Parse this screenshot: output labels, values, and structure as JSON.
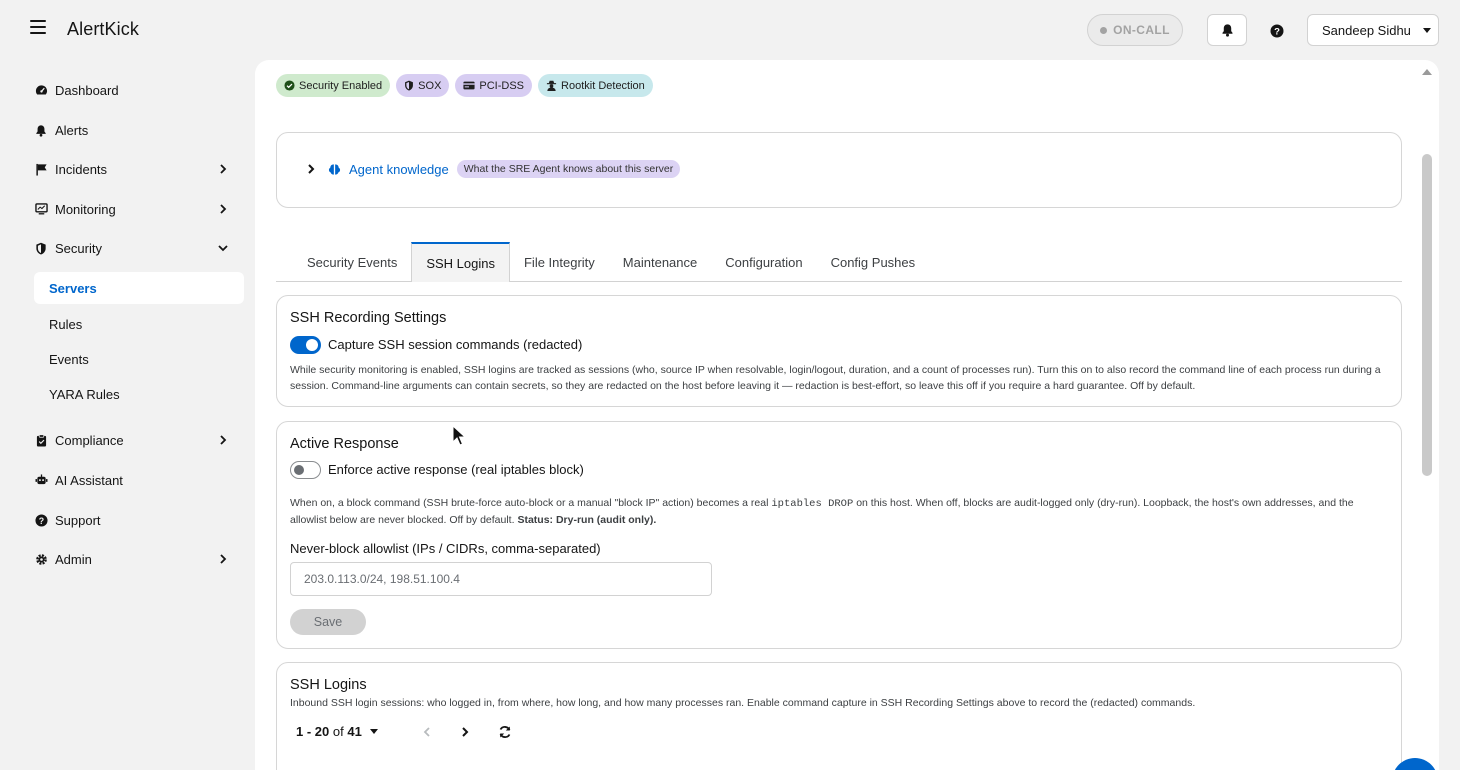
{
  "header": {
    "brand": "AlertKick",
    "oncall_label": "ON-CALL",
    "user_name": "Sandeep Sidhu"
  },
  "sidebar": {
    "items": [
      {
        "label": "Dashboard",
        "icon": "dashboard-icon"
      },
      {
        "label": "Alerts",
        "icon": "bell-icon"
      },
      {
        "label": "Incidents",
        "icon": "flag-icon"
      },
      {
        "label": "Monitoring",
        "icon": "monitor-icon"
      },
      {
        "label": "Security",
        "icon": "shield-icon"
      },
      {
        "label": "Compliance",
        "icon": "clipboard-icon"
      },
      {
        "label": "AI Assistant",
        "icon": "robot-icon"
      },
      {
        "label": "Support",
        "icon": "help-circle-icon"
      },
      {
        "label": "Admin",
        "icon": "gear-icon"
      }
    ],
    "security_sub": [
      "Servers",
      "Rules",
      "Events",
      "YARA Rules"
    ]
  },
  "badges": [
    "Security Enabled",
    "SOX",
    "PCI-DSS",
    "Rootkit Detection"
  ],
  "agent": {
    "link": "Agent knowledge",
    "tag": "What the SRE Agent knows about this server"
  },
  "tabs": [
    "Security Events",
    "SSH Logins",
    "File Integrity",
    "Maintenance",
    "Configuration",
    "Config Pushes"
  ],
  "ssh_recording": {
    "title": "SSH Recording Settings",
    "toggle_label": "Capture SSH session commands (redacted)",
    "description": "While security monitoring is enabled, SSH logins are tracked as sessions (who, source IP when resolvable, login/logout, duration, and a count of processes run). Turn this on to also record the command line of each process run during a session. Command-line arguments can contain secrets, so they are redacted on the host before leaving it — redaction is best-effort, so leave this off if you require a hard guarantee. Off by default."
  },
  "active_response": {
    "title": "Active Response",
    "toggle_label": "Enforce active response (real iptables block)",
    "desc_before": "When on, a block command (SSH brute-force auto-block or a manual \"block IP\" action) becomes a real ",
    "desc_code": "iptables DROP",
    "desc_after": " on this host. When off, blocks are audit-logged only (dry-run). Loopback, the host's own addresses, and the allowlist below are never blocked. Off by default. ",
    "desc_status": "Status: Dry-run (audit only).",
    "allowlist_label": "Never-block allowlist (IPs / CIDRs, comma-separated)",
    "allowlist_value": "203.0.113.0/24, 198.51.100.4",
    "save_label": "Save"
  },
  "ssh_logins": {
    "title": "SSH Logins",
    "description": "Inbound SSH login sessions: who logged in, from where, how long, and how many processes ran. Enable command capture in SSH Recording Settings above to record the (redacted) commands.",
    "range": "1 - 20",
    "of_label": "of",
    "total": "41"
  }
}
